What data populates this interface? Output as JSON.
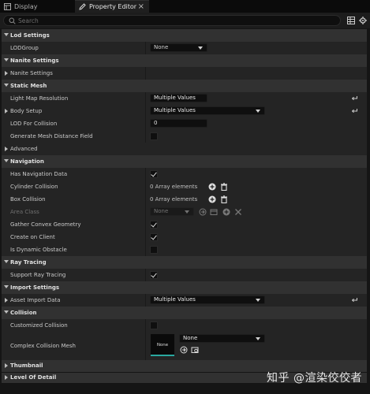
{
  "tabs": [
    {
      "label": "Display",
      "icon": "grid-icon",
      "active": false
    },
    {
      "label": "Property Editor",
      "icon": "pencil-icon",
      "active": true
    }
  ],
  "search": {
    "placeholder": "Search"
  },
  "sections": {
    "lod_settings": "Lod Settings",
    "nanite_settings": "Nanite Settings",
    "static_mesh": "Static Mesh",
    "navigation": "Navigation",
    "ray_tracing": "Ray Tracing",
    "import_settings": "Import Settings",
    "collision": "Collision",
    "thumbnail": "Thumbnail",
    "level_of_detail": "Level Of Detail"
  },
  "properties": {
    "lod_group": {
      "label": "LODGroup",
      "value": "None"
    },
    "nanite_settings": {
      "label": "Nanite Settings"
    },
    "light_map_resolution": {
      "label": "Light Map Resolution",
      "value": "Multiple Values"
    },
    "body_setup": {
      "label": "Body Setup",
      "value": "Multiple Values"
    },
    "lod_for_collision": {
      "label": "LOD For Collision",
      "value": "0"
    },
    "generate_mesh_distance_field": {
      "label": "Generate Mesh Distance Field",
      "checked": false
    },
    "advanced": {
      "label": "Advanced"
    },
    "has_navigation_data": {
      "label": "Has Navigation Data",
      "checked": true
    },
    "cylinder_collision": {
      "label": "Cylinder Collision",
      "value": "0 Array elements"
    },
    "box_collision": {
      "label": "Box Collision",
      "value": "0 Array elements"
    },
    "area_class": {
      "label": "Area Class",
      "value": "None"
    },
    "gather_convex_geometry": {
      "label": "Gather Convex Geometry",
      "checked": true
    },
    "create_on_client": {
      "label": "Create on Client",
      "checked": true
    },
    "is_dynamic_obstacle": {
      "label": "Is Dynamic Obstacle",
      "checked": false
    },
    "support_ray_tracing": {
      "label": "Support Ray Tracing",
      "checked": true
    },
    "asset_import_data": {
      "label": "Asset Import Data",
      "value": "Multiple Values"
    },
    "customized_collision": {
      "label": "Customized Collision",
      "checked": false
    },
    "complex_collision_mesh": {
      "label": "Complex Collision Mesh",
      "value": "None",
      "thumb_label": "None"
    }
  },
  "watermark": "知乎 @渲染佼佼者",
  "colors": {
    "background": "#151515",
    "row": "#242424",
    "category": "#313131",
    "accent": "#2aa8a0"
  }
}
